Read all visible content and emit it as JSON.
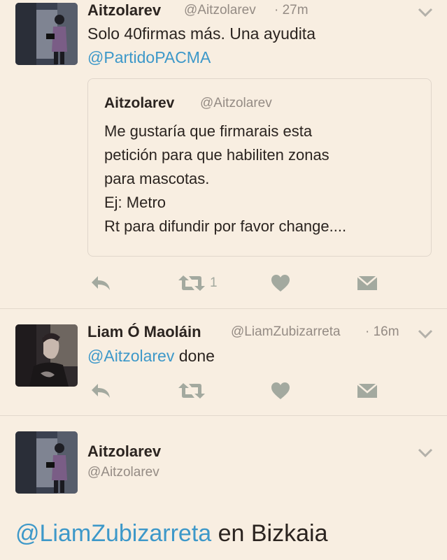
{
  "tweets": [
    {
      "name": "Aitzolarev",
      "handle": "@Aitzolarev",
      "time": "· 27m",
      "text_line1": "Solo 40firmas más. Una ayudita",
      "mention": "@PartidoPACMA",
      "retweet_count": "1",
      "quote": {
        "name": "Aitzolarev",
        "handle": "@Aitzolarev",
        "text": "Me gustaría que firmarais esta\npetición para que habiliten zonas\npara mascotas.\nEj: Metro\nRt para difundir por favor change...."
      }
    },
    {
      "name": "Liam Ó Maoláin",
      "handle": "@LiamZubizarreta",
      "time": "· 16m",
      "mention": "@Aitzolarev",
      "text": " done"
    }
  ],
  "detail": {
    "name": "Aitzolarev",
    "handle": "@Aitzolarev",
    "mention": "@LiamZubizarreta",
    "text": " en Bizkaia"
  },
  "icons": [
    "reply-icon",
    "retweet-icon",
    "like-icon",
    "dm-icon",
    "chevron-down-icon"
  ],
  "colors": {
    "background": "#f8eee1",
    "mention": "#3d98c9",
    "icon": "#a3a99f",
    "handle": "#948b84",
    "text": "#2b2420"
  }
}
